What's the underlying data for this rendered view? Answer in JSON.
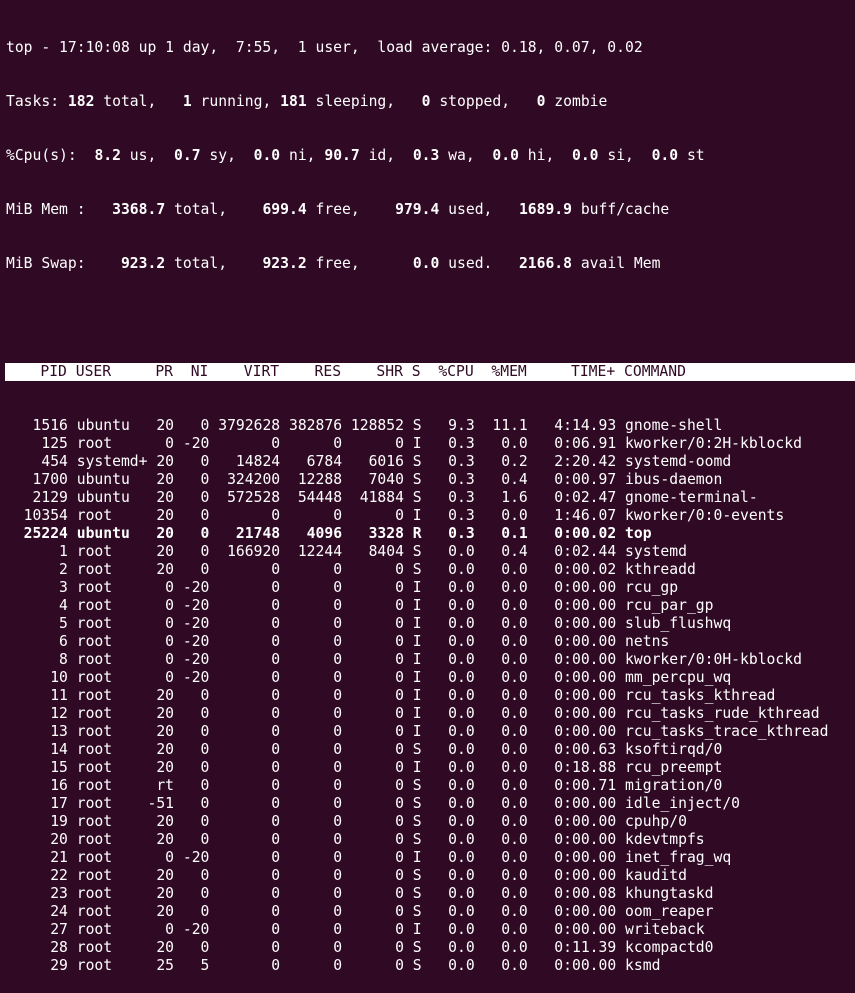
{
  "summary": {
    "uptime_line": "top - 17:10:08 up 1 day,  7:55,  1 user,  load average: 0.18, 0.07, 0.02",
    "tasks": {
      "label": "Tasks:",
      "total": "182",
      "running": "1",
      "sleeping": "181",
      "stopped": "0",
      "zombie": "0"
    },
    "cpu": {
      "label": "%Cpu(s):",
      "us": "8.2",
      "sy": "0.7",
      "ni": "0.0",
      "id": "90.7",
      "wa": "0.3",
      "hi": "0.0",
      "si": "0.0",
      "st": "0.0"
    },
    "mem": {
      "label": "MiB Mem :",
      "total": "3368.7",
      "free": "699.4",
      "used": "979.4",
      "buff_cache": "1689.9"
    },
    "swap": {
      "label": "MiB Swap:",
      "total": "923.2",
      "free": "923.2",
      "used": "0.0",
      "avail_mem": "2166.8"
    }
  },
  "columns": [
    "PID",
    "USER",
    "PR",
    "NI",
    "VIRT",
    "RES",
    "SHR",
    "S",
    "%CPU",
    "%MEM",
    "TIME+",
    "COMMAND"
  ],
  "processes": [
    {
      "pid": "1516",
      "user": "ubuntu",
      "pr": "20",
      "ni": "0",
      "virt": "3792628",
      "res": "382876",
      "shr": "128852",
      "s": "S",
      "cpu": "9.3",
      "mem": "11.1",
      "time": "4:14.93",
      "command": "gnome-shell"
    },
    {
      "pid": "125",
      "user": "root",
      "pr": "0",
      "ni": "-20",
      "virt": "0",
      "res": "0",
      "shr": "0",
      "s": "I",
      "cpu": "0.3",
      "mem": "0.0",
      "time": "0:06.91",
      "command": "kworker/0:2H-kblockd"
    },
    {
      "pid": "454",
      "user": "systemd+",
      "pr": "20",
      "ni": "0",
      "virt": "14824",
      "res": "6784",
      "shr": "6016",
      "s": "S",
      "cpu": "0.3",
      "mem": "0.2",
      "time": "2:20.42",
      "command": "systemd-oomd"
    },
    {
      "pid": "1700",
      "user": "ubuntu",
      "pr": "20",
      "ni": "0",
      "virt": "324200",
      "res": "12288",
      "shr": "7040",
      "s": "S",
      "cpu": "0.3",
      "mem": "0.4",
      "time": "0:00.97",
      "command": "ibus-daemon"
    },
    {
      "pid": "2129",
      "user": "ubuntu",
      "pr": "20",
      "ni": "0",
      "virt": "572528",
      "res": "54448",
      "shr": "41884",
      "s": "S",
      "cpu": "0.3",
      "mem": "1.6",
      "time": "0:02.47",
      "command": "gnome-terminal-"
    },
    {
      "pid": "10354",
      "user": "root",
      "pr": "20",
      "ni": "0",
      "virt": "0",
      "res": "0",
      "shr": "0",
      "s": "I",
      "cpu": "0.3",
      "mem": "0.0",
      "time": "1:46.07",
      "command": "kworker/0:0-events"
    },
    {
      "pid": "25224",
      "user": "ubuntu",
      "pr": "20",
      "ni": "0",
      "virt": "21748",
      "res": "4096",
      "shr": "3328",
      "s": "R",
      "cpu": "0.3",
      "mem": "0.1",
      "time": "0:00.02",
      "command": "top",
      "bold": true
    },
    {
      "pid": "1",
      "user": "root",
      "pr": "20",
      "ni": "0",
      "virt": "166920",
      "res": "12244",
      "shr": "8404",
      "s": "S",
      "cpu": "0.0",
      "mem": "0.4",
      "time": "0:02.44",
      "command": "systemd"
    },
    {
      "pid": "2",
      "user": "root",
      "pr": "20",
      "ni": "0",
      "virt": "0",
      "res": "0",
      "shr": "0",
      "s": "S",
      "cpu": "0.0",
      "mem": "0.0",
      "time": "0:00.02",
      "command": "kthreadd"
    },
    {
      "pid": "3",
      "user": "root",
      "pr": "0",
      "ni": "-20",
      "virt": "0",
      "res": "0",
      "shr": "0",
      "s": "I",
      "cpu": "0.0",
      "mem": "0.0",
      "time": "0:00.00",
      "command": "rcu_gp"
    },
    {
      "pid": "4",
      "user": "root",
      "pr": "0",
      "ni": "-20",
      "virt": "0",
      "res": "0",
      "shr": "0",
      "s": "I",
      "cpu": "0.0",
      "mem": "0.0",
      "time": "0:00.00",
      "command": "rcu_par_gp"
    },
    {
      "pid": "5",
      "user": "root",
      "pr": "0",
      "ni": "-20",
      "virt": "0",
      "res": "0",
      "shr": "0",
      "s": "I",
      "cpu": "0.0",
      "mem": "0.0",
      "time": "0:00.00",
      "command": "slub_flushwq"
    },
    {
      "pid": "6",
      "user": "root",
      "pr": "0",
      "ni": "-20",
      "virt": "0",
      "res": "0",
      "shr": "0",
      "s": "I",
      "cpu": "0.0",
      "mem": "0.0",
      "time": "0:00.00",
      "command": "netns"
    },
    {
      "pid": "8",
      "user": "root",
      "pr": "0",
      "ni": "-20",
      "virt": "0",
      "res": "0",
      "shr": "0",
      "s": "I",
      "cpu": "0.0",
      "mem": "0.0",
      "time": "0:00.00",
      "command": "kworker/0:0H-kblockd"
    },
    {
      "pid": "10",
      "user": "root",
      "pr": "0",
      "ni": "-20",
      "virt": "0",
      "res": "0",
      "shr": "0",
      "s": "I",
      "cpu": "0.0",
      "mem": "0.0",
      "time": "0:00.00",
      "command": "mm_percpu_wq"
    },
    {
      "pid": "11",
      "user": "root",
      "pr": "20",
      "ni": "0",
      "virt": "0",
      "res": "0",
      "shr": "0",
      "s": "I",
      "cpu": "0.0",
      "mem": "0.0",
      "time": "0:00.00",
      "command": "rcu_tasks_kthread"
    },
    {
      "pid": "12",
      "user": "root",
      "pr": "20",
      "ni": "0",
      "virt": "0",
      "res": "0",
      "shr": "0",
      "s": "I",
      "cpu": "0.0",
      "mem": "0.0",
      "time": "0:00.00",
      "command": "rcu_tasks_rude_kthread"
    },
    {
      "pid": "13",
      "user": "root",
      "pr": "20",
      "ni": "0",
      "virt": "0",
      "res": "0",
      "shr": "0",
      "s": "I",
      "cpu": "0.0",
      "mem": "0.0",
      "time": "0:00.00",
      "command": "rcu_tasks_trace_kthread"
    },
    {
      "pid": "14",
      "user": "root",
      "pr": "20",
      "ni": "0",
      "virt": "0",
      "res": "0",
      "shr": "0",
      "s": "S",
      "cpu": "0.0",
      "mem": "0.0",
      "time": "0:00.63",
      "command": "ksoftirqd/0"
    },
    {
      "pid": "15",
      "user": "root",
      "pr": "20",
      "ni": "0",
      "virt": "0",
      "res": "0",
      "shr": "0",
      "s": "I",
      "cpu": "0.0",
      "mem": "0.0",
      "time": "0:18.88",
      "command": "rcu_preempt"
    },
    {
      "pid": "16",
      "user": "root",
      "pr": "rt",
      "ni": "0",
      "virt": "0",
      "res": "0",
      "shr": "0",
      "s": "S",
      "cpu": "0.0",
      "mem": "0.0",
      "time": "0:00.71",
      "command": "migration/0"
    },
    {
      "pid": "17",
      "user": "root",
      "pr": "-51",
      "ni": "0",
      "virt": "0",
      "res": "0",
      "shr": "0",
      "s": "S",
      "cpu": "0.0",
      "mem": "0.0",
      "time": "0:00.00",
      "command": "idle_inject/0"
    },
    {
      "pid": "19",
      "user": "root",
      "pr": "20",
      "ni": "0",
      "virt": "0",
      "res": "0",
      "shr": "0",
      "s": "S",
      "cpu": "0.0",
      "mem": "0.0",
      "time": "0:00.00",
      "command": "cpuhp/0"
    },
    {
      "pid": "20",
      "user": "root",
      "pr": "20",
      "ni": "0",
      "virt": "0",
      "res": "0",
      "shr": "0",
      "s": "S",
      "cpu": "0.0",
      "mem": "0.0",
      "time": "0:00.00",
      "command": "kdevtmpfs"
    },
    {
      "pid": "21",
      "user": "root",
      "pr": "0",
      "ni": "-20",
      "virt": "0",
      "res": "0",
      "shr": "0",
      "s": "I",
      "cpu": "0.0",
      "mem": "0.0",
      "time": "0:00.00",
      "command": "inet_frag_wq"
    },
    {
      "pid": "22",
      "user": "root",
      "pr": "20",
      "ni": "0",
      "virt": "0",
      "res": "0",
      "shr": "0",
      "s": "S",
      "cpu": "0.0",
      "mem": "0.0",
      "time": "0:00.00",
      "command": "kauditd"
    },
    {
      "pid": "23",
      "user": "root",
      "pr": "20",
      "ni": "0",
      "virt": "0",
      "res": "0",
      "shr": "0",
      "s": "S",
      "cpu": "0.0",
      "mem": "0.0",
      "time": "0:00.08",
      "command": "khungtaskd"
    },
    {
      "pid": "24",
      "user": "root",
      "pr": "20",
      "ni": "0",
      "virt": "0",
      "res": "0",
      "shr": "0",
      "s": "S",
      "cpu": "0.0",
      "mem": "0.0",
      "time": "0:00.00",
      "command": "oom_reaper"
    },
    {
      "pid": "27",
      "user": "root",
      "pr": "0",
      "ni": "-20",
      "virt": "0",
      "res": "0",
      "shr": "0",
      "s": "I",
      "cpu": "0.0",
      "mem": "0.0",
      "time": "0:00.00",
      "command": "writeback"
    },
    {
      "pid": "28",
      "user": "root",
      "pr": "20",
      "ni": "0",
      "virt": "0",
      "res": "0",
      "shr": "0",
      "s": "S",
      "cpu": "0.0",
      "mem": "0.0",
      "time": "0:11.39",
      "command": "kcompactd0"
    },
    {
      "pid": "29",
      "user": "root",
      "pr": "25",
      "ni": "5",
      "virt": "0",
      "res": "0",
      "shr": "0",
      "s": "S",
      "cpu": "0.0",
      "mem": "0.0",
      "time": "0:00.00",
      "command": "ksmd"
    }
  ],
  "colors": {
    "background": "#300a24",
    "foreground": "#ffffff"
  }
}
